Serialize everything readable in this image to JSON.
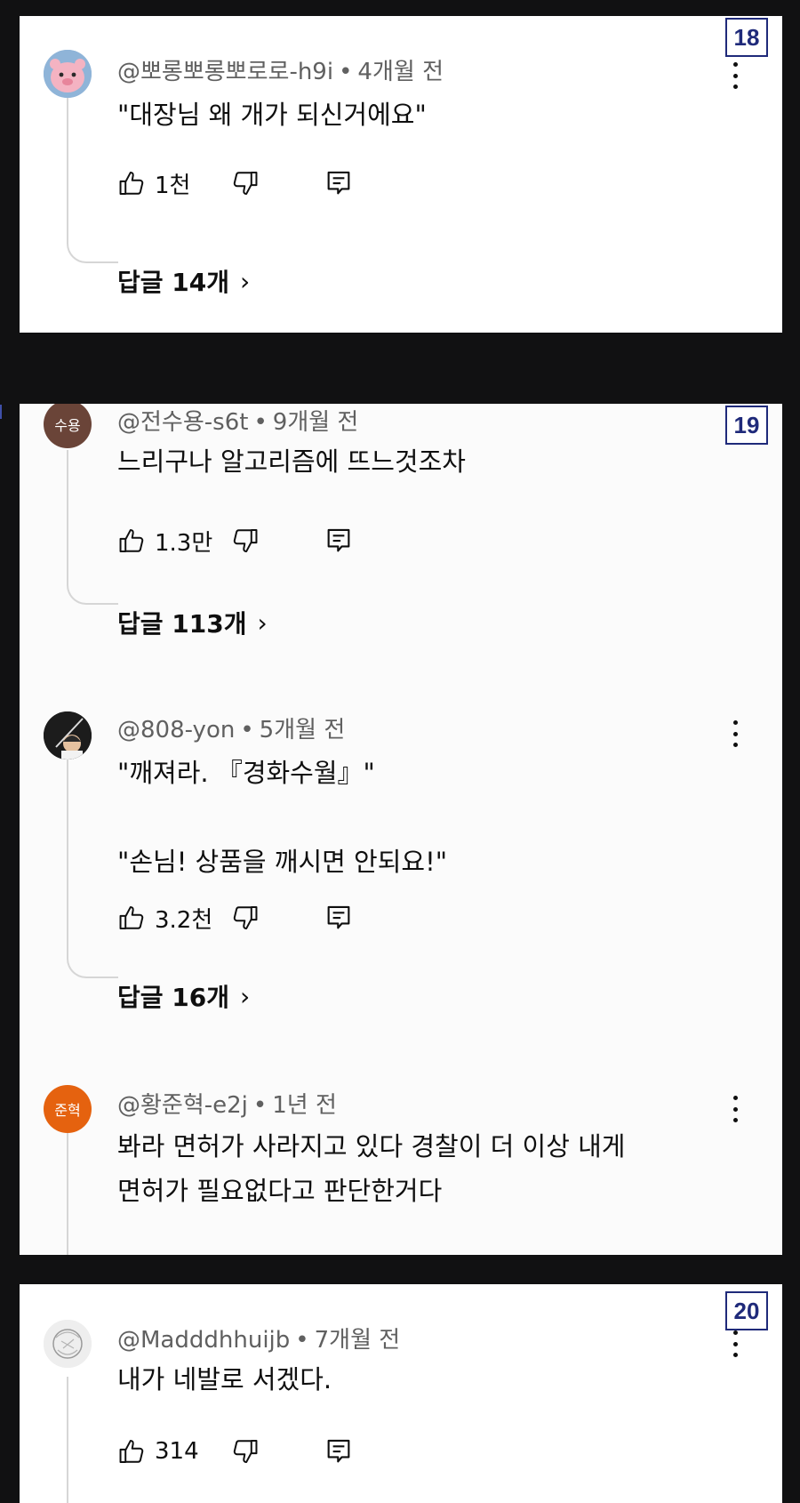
{
  "colors": {
    "page_bg": "#111112",
    "card_bg": "#ffffff",
    "badge": "#1f2a7a",
    "meta": "#606060"
  },
  "cards": [
    {
      "badge": "18",
      "comments": [
        {
          "avatar_icon": "pink-character-avatar",
          "author": "@뽀롱뽀롱뽀로로-h9i",
          "time": "4개월 전",
          "lines": [
            "\"대장님 왜 개가 되신거에요\""
          ],
          "likes": "1천",
          "replies": "답글 14개"
        }
      ]
    },
    {
      "badge": "19",
      "comments": [
        {
          "avatar_text": "수용",
          "author": "@전수용-s6t",
          "time": "9개월 전",
          "lines": [
            "느리구나 알고리즘에 뜨느것조차"
          ],
          "likes": "1.3만",
          "replies": "답글 113개"
        },
        {
          "avatar_icon": "photo-avatar",
          "author": "@808-yon",
          "time": "5개월 전",
          "lines": [
            "\"깨져라. 『경화수월』\"",
            "",
            "\"손님! 상품을 깨시면 안되요!\""
          ],
          "likes": "3.2천",
          "replies": "답글 16개"
        },
        {
          "avatar_text": "준혁",
          "author": "@황준혁-e2j",
          "time": "1년 전",
          "lines": [
            "봐라 면허가 사라지고 있다 경찰이 더 이상 내게",
            "면허가 필요없다고 판단한거다"
          ]
        }
      ]
    },
    {
      "badge": "20",
      "comments": [
        {
          "avatar_icon": "sketch-avatar",
          "author": "@Madddhhuijb",
          "time": "7개월 전",
          "lines": [
            "내가 네발로 서겠다."
          ],
          "likes": "314"
        }
      ]
    }
  ],
  "icons": {
    "like": "thumb-up-icon",
    "dislike": "thumb-down-icon",
    "reply": "reply-icon",
    "more": "more-vert-icon",
    "chevron": "chevron-right-icon"
  }
}
